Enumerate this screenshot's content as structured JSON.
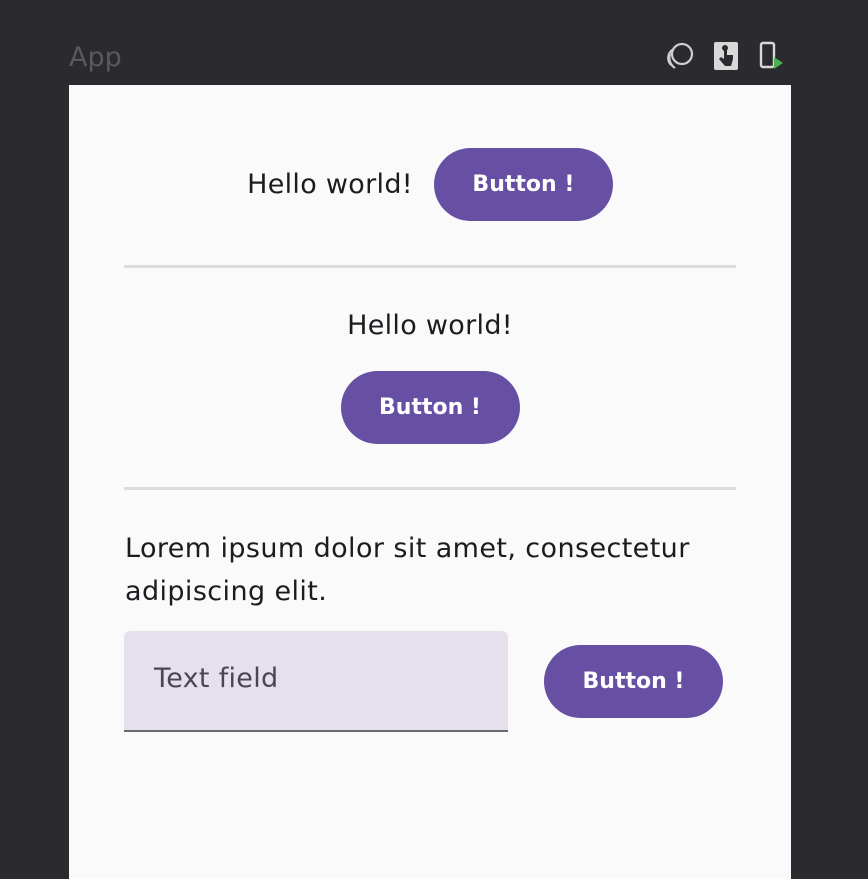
{
  "window": {
    "title": "App",
    "icons": [
      "interactive-mode-icon",
      "touch-mode-icon",
      "run-on-device-icon"
    ]
  },
  "section1": {
    "text": "Hello world!",
    "button_label": "Button !"
  },
  "section2": {
    "text": "Hello world!",
    "button_label": "Button !"
  },
  "section3": {
    "paragraph": "Lorem ipsum dolor sit amet, consectetur adipiscing elit.",
    "text_field_placeholder": "Text field",
    "button_label": "Button !"
  },
  "colors": {
    "primary": "#6750a4",
    "on_primary": "#ffffff",
    "surface": "#fafafa",
    "field_container": "#e6dfec",
    "background": "#2b2a2e"
  }
}
